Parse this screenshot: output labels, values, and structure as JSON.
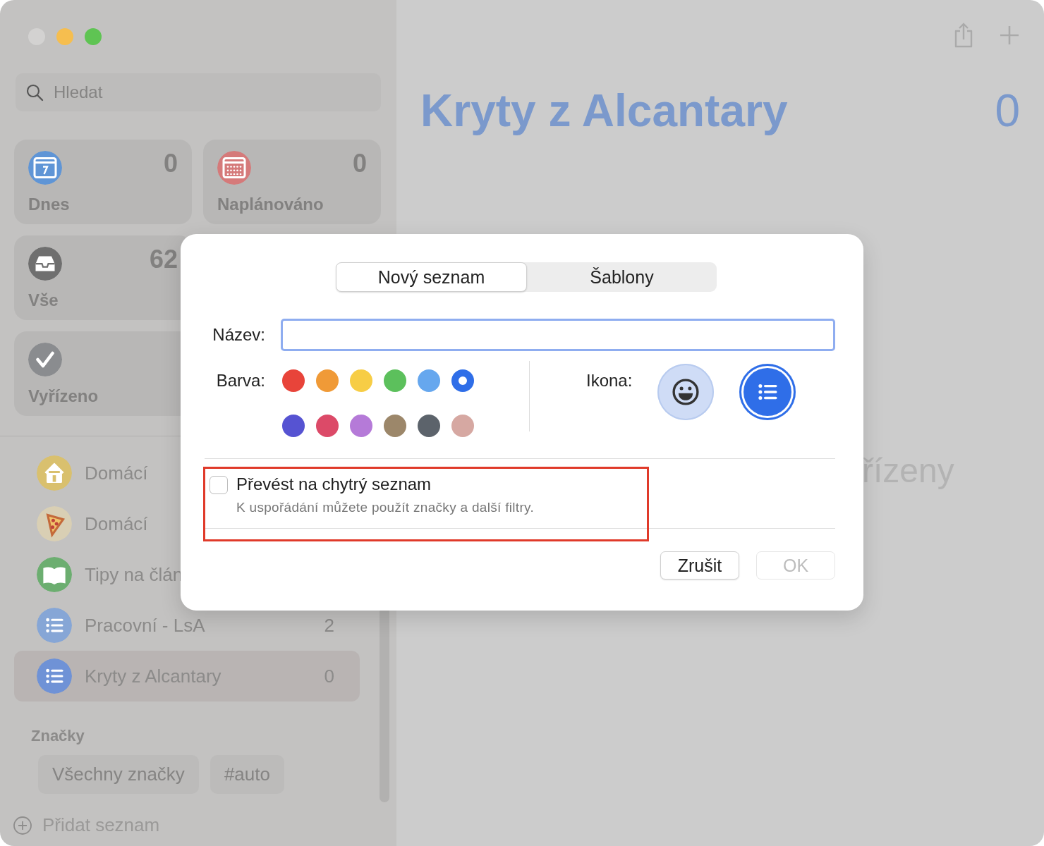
{
  "sidebar": {
    "search": {
      "placeholder": "Hledat"
    },
    "smart_lists": [
      {
        "label": "Dnes",
        "count": "0",
        "kind": "calendar-day",
        "color": "#5f95d6"
      },
      {
        "label": "Naplánováno",
        "count": "0",
        "kind": "calendar-grid",
        "color": "#d57a7a"
      },
      {
        "label": "Vše",
        "count": "62",
        "kind": "tray",
        "color": "#6f6f6f"
      },
      {
        "label": "Vyřízeno",
        "kind": "check",
        "color": "#8a8c8f"
      }
    ],
    "lists": [
      {
        "label": "Domácí",
        "kind": "house",
        "color": "#d9c06e",
        "selected": false
      },
      {
        "label": "Domácí",
        "kind": "pizza",
        "color": "#d9cfb4",
        "selected": false
      },
      {
        "label": "Tipy na člán",
        "kind": "book",
        "color": "#6cae70",
        "selected": false
      },
      {
        "label": "Pracovní - LsA",
        "count": "2",
        "kind": "list",
        "color": "#86a6d6",
        "selected": false
      },
      {
        "label": "Kryty z Alcantary",
        "count": "0",
        "kind": "list",
        "color": "#6f92d6",
        "selected": true
      }
    ],
    "tags_heading": "Značky",
    "tags": [
      "Všechny značky",
      "#auto"
    ],
    "add_list": "Přidat seznam"
  },
  "main": {
    "title": "Kryty z Alcantary",
    "count": "0",
    "empty_message": "řízeny"
  },
  "dialog": {
    "tabs": [
      {
        "label": "Nový seznam",
        "selected": true
      },
      {
        "label": "Šablony",
        "selected": false
      }
    ],
    "name_label": "Název:",
    "color_label": "Barva:",
    "colors": [
      {
        "color": "#e8443a",
        "selected": false
      },
      {
        "color": "#f09a37",
        "selected": false
      },
      {
        "color": "#f7cd45",
        "selected": false
      },
      {
        "color": "#5cc05c",
        "selected": false
      },
      {
        "color": "#66a7ee",
        "selected": false
      },
      {
        "color": "#2f6ee8",
        "selected": true
      },
      {
        "color": "#5653d2",
        "selected": false
      },
      {
        "color": "#dc4a68",
        "selected": false
      },
      {
        "color": "#b57ad8",
        "selected": false
      },
      {
        "color": "#9c876a",
        "selected": false
      },
      {
        "color": "#5c636b",
        "selected": false
      },
      {
        "color": "#d6a8a2",
        "selected": false
      }
    ],
    "icon_label": "Ikona:",
    "icons": [
      {
        "kind": "emoji",
        "selected": false
      },
      {
        "kind": "list",
        "selected": true
      }
    ],
    "smart_list": {
      "label": "Převést na chytrý seznam",
      "hint": "K uspořádání můžete použít značky a další filtry.",
      "checked": false
    },
    "buttons": [
      {
        "label": "Zrušit",
        "disabled": false
      },
      {
        "label": "OK",
        "disabled": true
      }
    ]
  }
}
